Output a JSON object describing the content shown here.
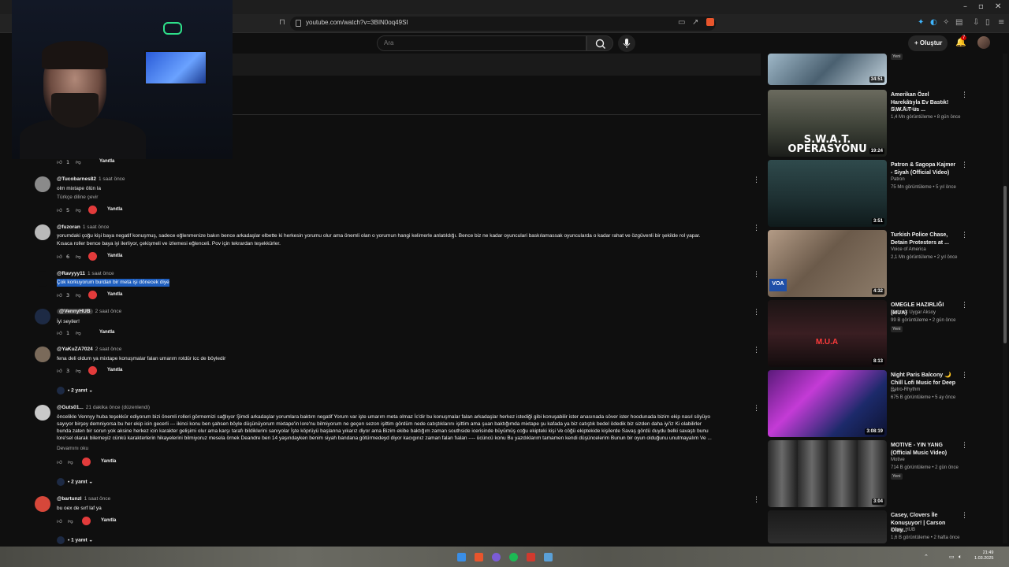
{
  "browser": {
    "url": "youtube.com/watch?v=3BIN0oq49SI",
    "window_controls": [
      "–",
      "▫",
      "✕"
    ]
  },
  "header": {
    "search_placeholder": "Ara",
    "create_label": "Oluştur",
    "notif_count": "7"
  },
  "comments": [
    {
      "author": "@Tucobarnes82",
      "time": "1 saat önce",
      "lines": [
        "olm mixtape ölün la"
      ],
      "translate": "Türkçe diline çevir",
      "likes": "5",
      "reply": "Yanıtla",
      "hearted": true
    },
    {
      "author": "@fuzoran",
      "time": "1 saat önce",
      "lines": [
        "yorumdaki çoğu kişi baya negatif konuşmuş, sadece eğlenmenize bakın bence arkadaşlar elbette ki herkesin yorumu olur ama önemli olan o yorumun hangi kelimerle anlatıldığı. Bence biz ne kadar oyunculari baskılamassak oyunculardа o kadar rahat ve özgüvenli bir şekilde rol yapar.",
        "Kısaca roller bence baya iyi ilerliyor, çekişmeli ve izlemesi eğlenceli. Pov için tekrardan teşekkürler."
      ],
      "likes": "6",
      "reply": "Yanıtla",
      "hearted": true
    },
    {
      "author": "@Ravyyy11",
      "time": "1 saat önce",
      "lines": [
        "Çok korkuyorum burdan bir meta işi dönecek diye"
      ],
      "likes": "3",
      "reply": "Yanıtla",
      "hearted": true
    },
    {
      "author": "@VennyHUB",
      "time": "2 saat önce",
      "lines": [
        "İyi seyiler!"
      ],
      "likes": "1",
      "reply": "Yanıtla",
      "hearted": false
    },
    {
      "author": "@YaKuZA7024",
      "time": "2 saat önce",
      "lines": [
        "fena deli oldum ya mixtape konuşmalar falan umarım roldür icc de böyledir"
      ],
      "likes": "3",
      "reply": "Yanıtla",
      "hearted": true,
      "replies": "2 yanıt"
    },
    {
      "author": "@Guts01...",
      "time": "21 dakika önce (düzenlendi)",
      "lines": [
        "öncelikle Vennyy huba teşekkür ediyorum bizi önemli rolleri görmemizi sağlıyor Şimdi arkadaşlar yorumlara baktım negatif Yorum var işte umarım meta olmaz İc'dir bu konuşmalar falan arkadaşlar herkez istediği gibi konuşabilir ister anasınada söver ister hoodunada bizim ekip nasıl söyüyo",
        "sayıyor birşey demniyorsa bu her ekip icin gecerli --- ikinci konu ben şahsen böyle düşünüyorum mixtape'in lore'nu bilmiyorum ne geçen sezon işittim gördüm nede catıştıklarını  işittim ama şuan baktığımda mixtape şu kafada ya biz catıştık bedel ödedik biz sizden daha iyi'iz Ki olabilirler",
        "bunda zaten bir sorun yok aksine herkez icin karakter gelişimi olur ama karşı tarafı bildiklerini sanıyolar İşte köprüyü başlanna yıkarız diyor ama Bizim ekibe baktığım zaman southside icerisinde büyümüş coğu ekipteki kişi Ve cöğü ekiptekide kişilerde Savaş gördü duydu belki savaştı bunu",
        "lore'sel olarak bilemeyiz cünkü karakterlerin hikayelerini bilmiyoruz mesela örnek Deandre ben 14 yaşındayken benim siyah bandana götürmedeyd diyor kacıgınız zaman falan fıalan ---- ücüncü konu Bu yazdıklarım tamamen kendi düşüncelerim Bunun bir oyun olduğunu unutmayalım Ve ..."
      ],
      "more": "Devamını oku",
      "likes": "",
      "reply": "Yanıtla",
      "hearted": true,
      "replies": "2 yanıt"
    },
    {
      "author": "@bartunzl",
      "time": "1 saat önce",
      "lines": [
        "bu oex de sırf laf ya"
      ],
      "likes": "",
      "reply": "Yanıtla",
      "hearted": true,
      "replies": "1 yanıt"
    }
  ],
  "top_partial_reply": {
    "likes": "1",
    "reply": "Yanıtla"
  },
  "sidebar": [
    {
      "title": "",
      "channel": "",
      "meta": "",
      "duration": "34:51",
      "new": "Yeni"
    },
    {
      "title": "Amerikan Özel Harekâtıyla Ev Bastık! S.W.A.T us ...",
      "channel": "Alper Rende",
      "meta": "1,4 Mn görüntüleme • 8 gün önce",
      "duration": "19:24",
      "thumb_text": "S.W.A.T. OPERASYONU"
    },
    {
      "title": "Patron & Sagopa Kajmer - Siyah (Official Video)",
      "channel": "Patron",
      "meta": "75 Mn görüntüleme • 5 yıl önce",
      "duration": "3:51"
    },
    {
      "title": "Turkish Police Chase, Detain Protesters at ...",
      "channel": "Voice of America",
      "meta": "2,1 Mn görüntüleme • 2 yıl önce",
      "duration": "4:32",
      "thumb_text": "VOA"
    },
    {
      "title": "OMEGLE HAZIRLIĞI (MUA)",
      "channel": "Mehmet Uygar Aksoy",
      "meta": "99 B görüntüleme • 2 gün önce",
      "duration": "8:13",
      "new": "Yeni",
      "thumb_text": "M.U.A"
    },
    {
      "title": "Night Paris Balcony 🌙 Chill Lofi Music for Deep ...",
      "channel": "Retro-Rhythm",
      "meta": "675 B görüntüleme • 5 ay önce",
      "duration": "3:08:19"
    },
    {
      "title": "MOTIVE - YIN YANG (Official Music Video)",
      "channel": "Motive",
      "meta": "714 B görüntüleme • 2 gün önce",
      "duration": "3:04",
      "new": "Yeni"
    },
    {
      "title": "Casey, Clovers İle Konuşuyor! | Carson Olay...",
      "channel": "Venny HUB",
      "meta": "1,6 B görüntüleme • 2 hafta önce",
      "duration": ""
    }
  ],
  "taskbar": {
    "time": "21:49",
    "date": "1.03.2025"
  },
  "colors": {
    "accent_red": "#cc0000",
    "highlight": "#1f5fbf",
    "bg": "#0f0f0f"
  }
}
